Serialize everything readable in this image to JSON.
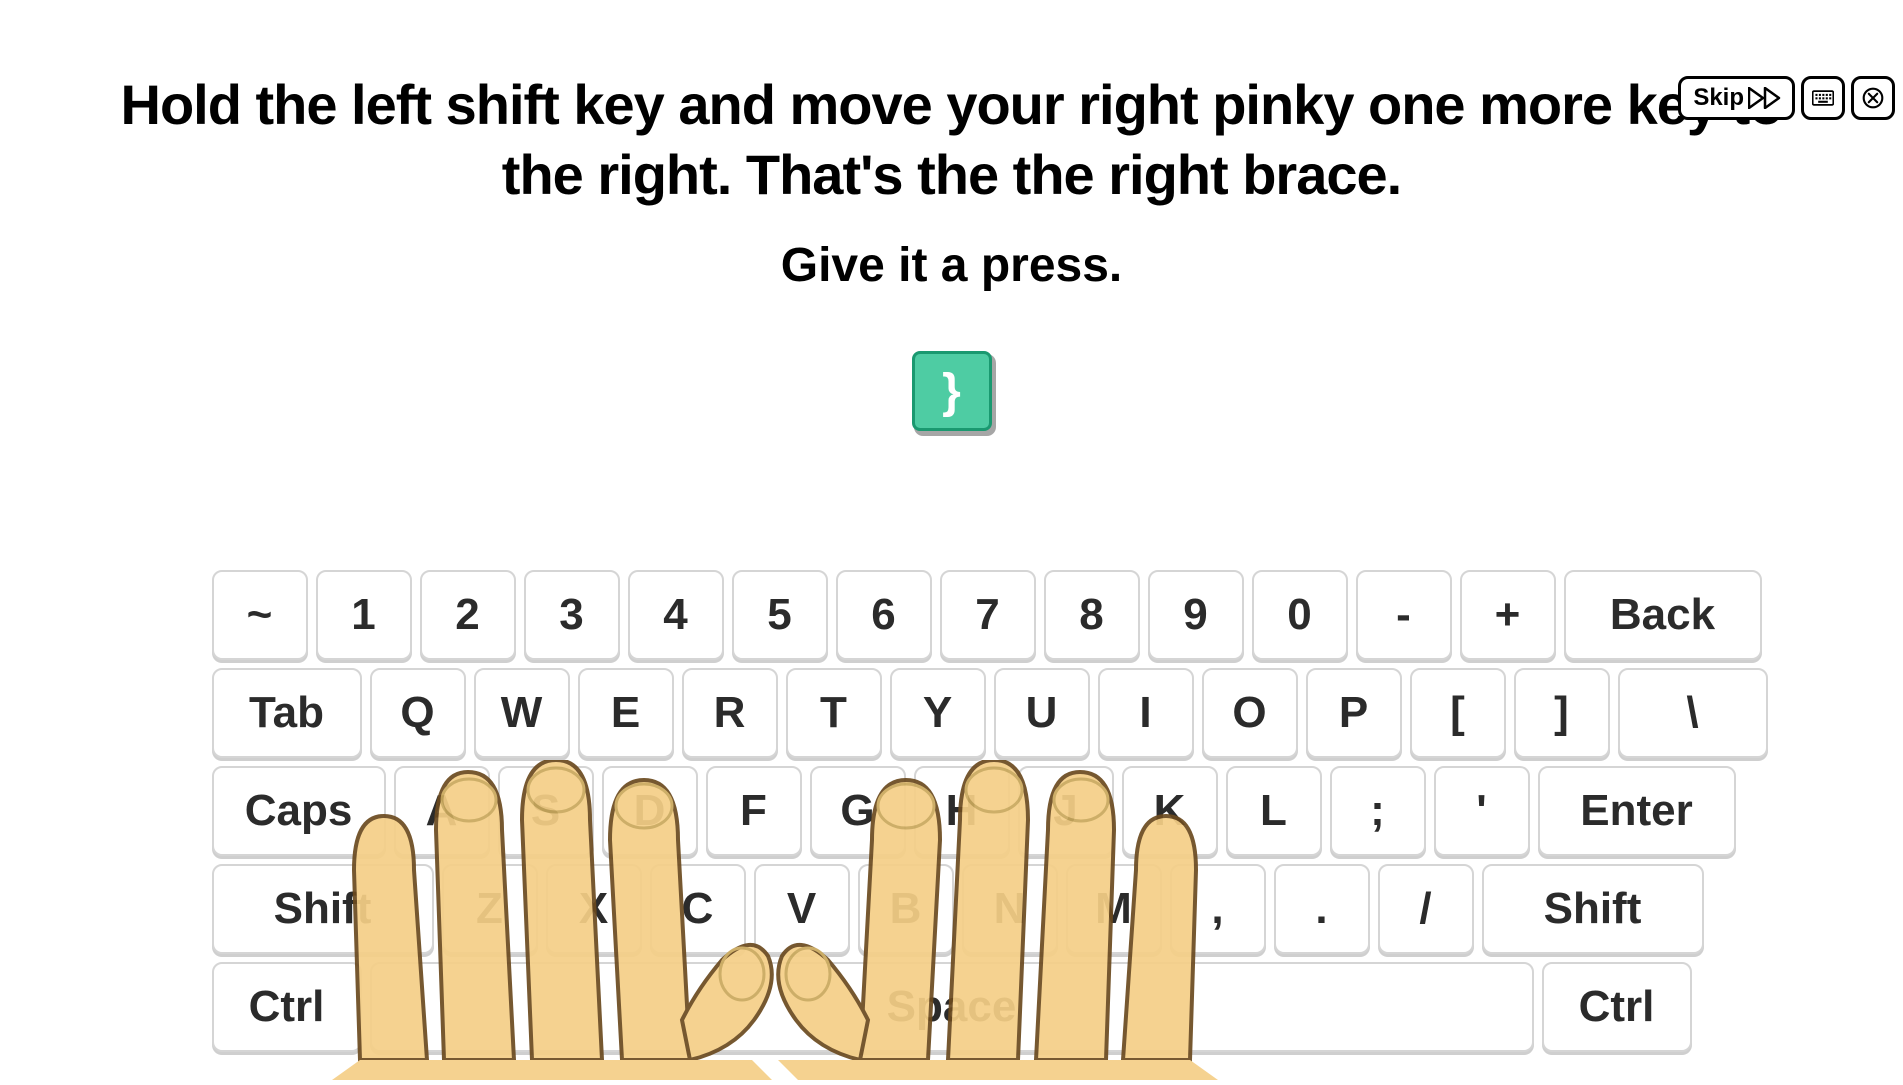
{
  "topbar": {
    "skip_label": "Skip"
  },
  "instruction": {
    "line1": "Hold the left shift key and move your right pinky one more key to the right. That's the the right brace.",
    "line2": "Give it a press."
  },
  "target_char": "}",
  "keyboard": {
    "row1": [
      "~",
      "1",
      "2",
      "3",
      "4",
      "5",
      "6",
      "7",
      "8",
      "9",
      "0",
      "-",
      "+",
      "Back"
    ],
    "row2": [
      "Tab",
      "Q",
      "W",
      "E",
      "R",
      "T",
      "Y",
      "U",
      "I",
      "O",
      "P",
      "[",
      "]",
      "\\"
    ],
    "row3": [
      "Caps",
      "A",
      "S",
      "D",
      "F",
      "G",
      "H",
      "J",
      "K",
      "L",
      ";",
      "'",
      "Enter"
    ],
    "row4": [
      "Shift",
      "Z",
      "X",
      "C",
      "V",
      "B",
      "N",
      "M",
      ",",
      ".",
      "/",
      "Shift"
    ],
    "row5": [
      "Ctrl",
      "Space",
      "Ctrl"
    ]
  }
}
